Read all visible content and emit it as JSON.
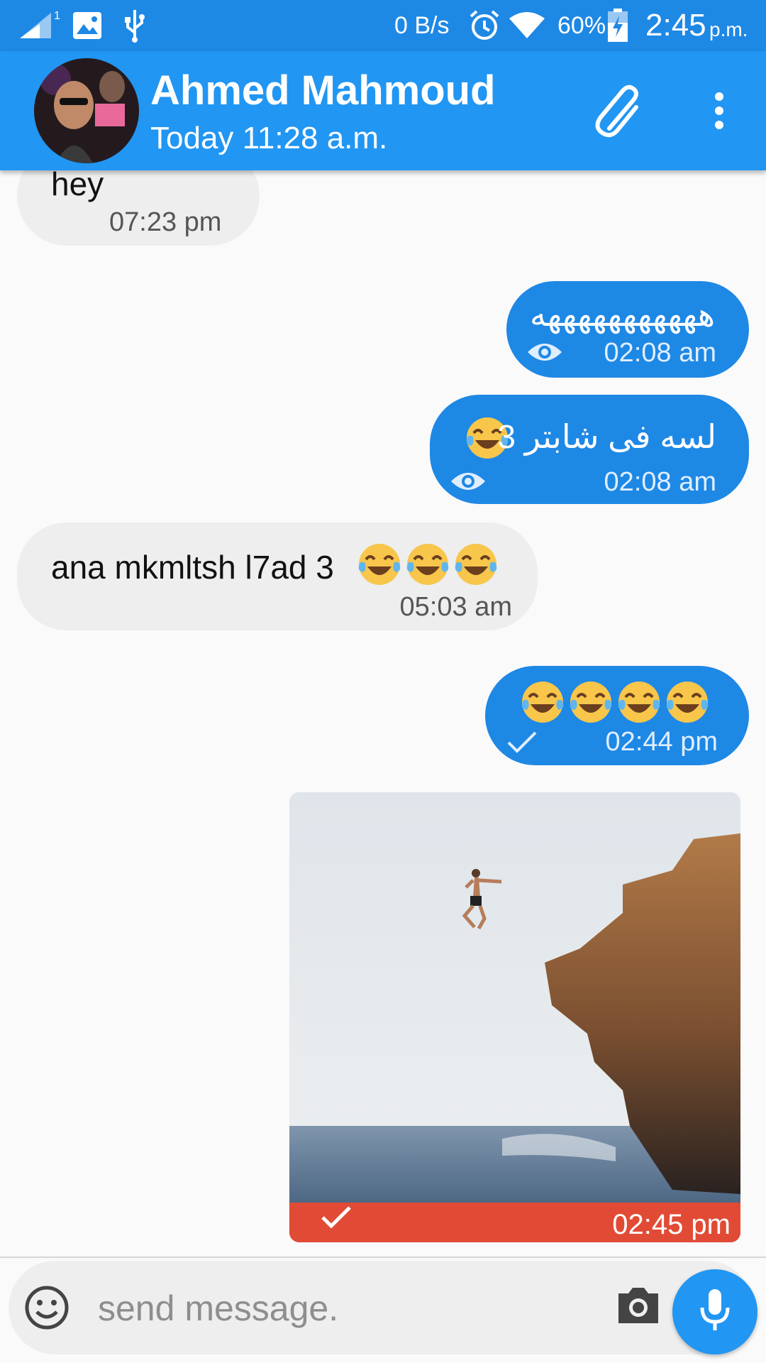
{
  "status_bar": {
    "data_speed": "0 B/s",
    "battery": "60%",
    "time": "2:45",
    "ampm": "p.m.",
    "sim_label": "1"
  },
  "header": {
    "contact_name": "Ahmed Mahmoud",
    "last_seen": "Today 11:28 a.m."
  },
  "messages": [
    {
      "direction": "incoming",
      "text": "hey",
      "time": "07:23 pm"
    },
    {
      "direction": "outgoing",
      "text": "هههههههههههه",
      "time": "02:08 am",
      "status_icon": "eye-icon"
    },
    {
      "direction": "outgoing",
      "text": "لسه فى شابتر 3",
      "emoji_count": 1,
      "time": "02:08 am",
      "status_icon": "eye-icon"
    },
    {
      "direction": "incoming",
      "text": "ana mkmltsh l7ad 3",
      "emoji_count": 3,
      "time": "05:03 am"
    },
    {
      "direction": "outgoing",
      "text": "",
      "emoji_count": 4,
      "time": "02:44 pm",
      "status_icon": "check-icon"
    },
    {
      "direction": "outgoing",
      "type": "image",
      "time": "02:45 pm",
      "status_icon": "check-icon"
    }
  ],
  "input": {
    "placeholder": "send message."
  },
  "colors": {
    "status_bar": "#1e88e5",
    "app_bar": "#2196f3",
    "outgoing_bubble": "#1e88e5",
    "incoming_bubble": "#eeeeee",
    "image_footer": "#e14b35"
  }
}
